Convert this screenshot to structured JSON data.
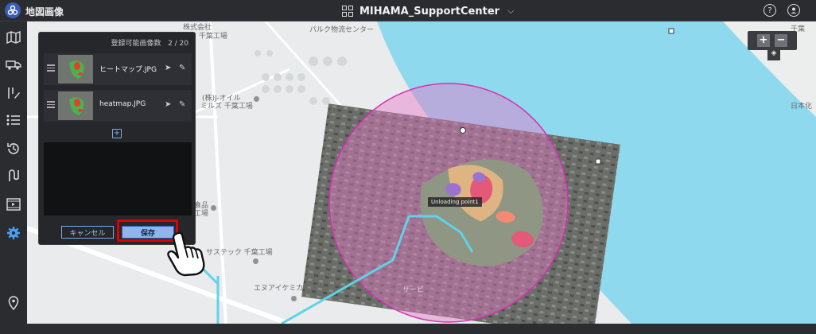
{
  "app": {
    "title": "地図画像"
  },
  "header": {
    "site_name": "MIHAMA_SupportCenter"
  },
  "panel": {
    "count_label": "登録可能画像数",
    "count_value": "2 / 20",
    "images": [
      {
        "name": "ヒートマップ.JPG"
      },
      {
        "name": "heatmap.JPG"
      }
    ],
    "cancel_label": "キャンセル",
    "save_label": "保存"
  },
  "map": {
    "labels": {
      "l1": "株式会社",
      "l2": "ッポン 千葉工場",
      "l3": "パルク物流センター",
      "l4": "(株)J-オイル",
      "l5": "ミルズ 千葉工場",
      "l6": "食品",
      "l7": "工場",
      "l8": "サステック 千葉工場",
      "l9": "エヌアイケミカル",
      "l10": "千葉",
      "l11": "日本化",
      "l12": "サービ"
    },
    "tooltip": "Unloading point1"
  },
  "colors": {
    "save_highlight": "#e00000",
    "circle_stroke": "#d62fb0",
    "path_color": "#5fd3e8"
  }
}
